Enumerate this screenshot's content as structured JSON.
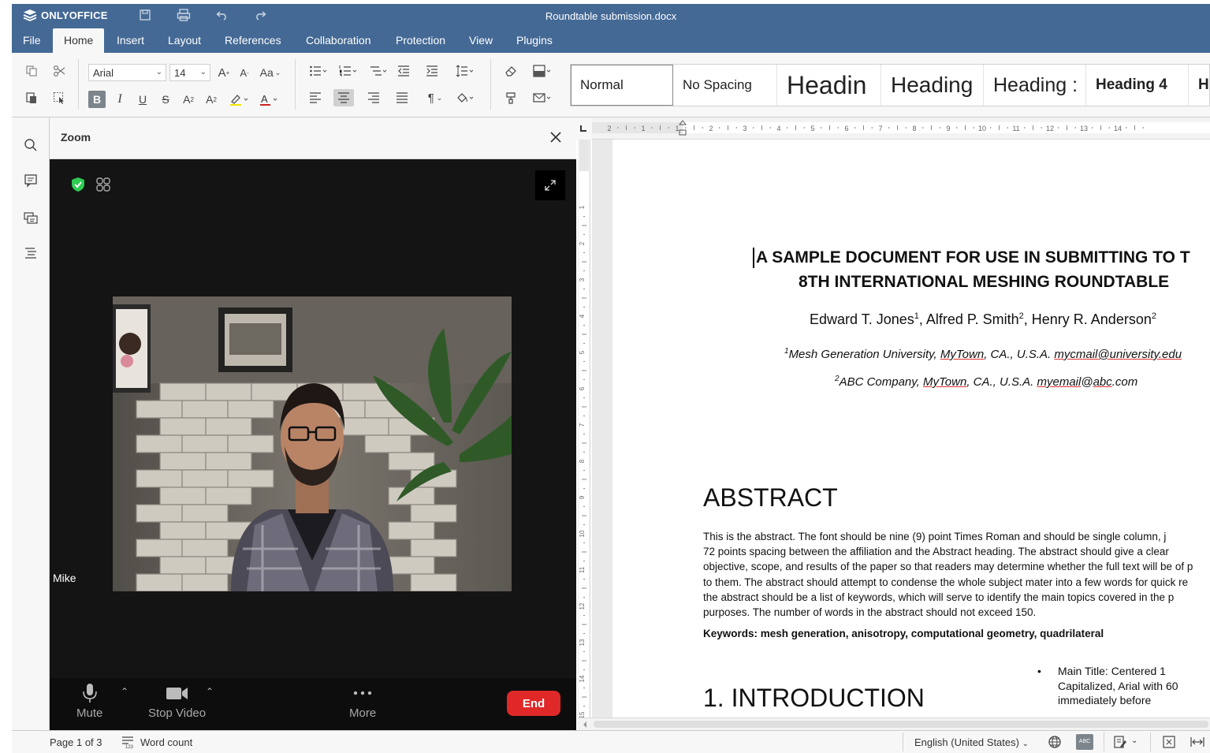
{
  "app": {
    "brand": "ONLYOFFICE",
    "document_title": "Roundtable submission.docx"
  },
  "menu": {
    "items": [
      "File",
      "Home",
      "Insert",
      "Layout",
      "References",
      "Collaboration",
      "Protection",
      "View",
      "Plugins"
    ],
    "active": "Home"
  },
  "toolbar": {
    "font_name": "Arial",
    "font_size": "14",
    "change_case_label": "Aa",
    "styles": [
      "Normal",
      "No Spacing",
      "Headin",
      "Heading",
      "Heading :",
      "Heading 4",
      "H"
    ]
  },
  "zoom_panel": {
    "title": "Zoom",
    "participant_name": "Mike",
    "controls": {
      "mute": "Mute",
      "stop_video": "Stop Video",
      "more": "More",
      "end": "End"
    }
  },
  "document": {
    "title_line1": "A SAMPLE DOCUMENT FOR USE IN SUBMITTING TO T",
    "title_line2": "8TH INTERNATIONAL MESHING ROUNDTABLE",
    "authors": {
      "a1": "Edward T. Jones",
      "sep1": ", ",
      "a2": "Alfred P. Smith",
      "sep2": ", ",
      "a3": "Henry R. Anderson",
      "s1": "1",
      "s2": "2",
      "s3": "2"
    },
    "affiliation1": {
      "sup": "1",
      "org": "Mesh Generation University, ",
      "town": "MyTown",
      "rest": ", CA., U.S.A. ",
      "email": "mycmail@university.edu"
    },
    "affiliation2": {
      "sup": "2",
      "org": "ABC Company, ",
      "town": "MyTown",
      "rest": ", CA., U.S.A. ",
      "email_user": "myemail",
      "email_at": "@",
      "email_domain": "abc",
      "email_tld": ".com"
    },
    "abstract_heading": "ABSTRACT",
    "abstract_lines": [
      "This is the abstract.  The font should be nine (9) point Times Roman and should be single column, j",
      "72 points spacing between the affiliation and the Abstract heading.  The abstract should give a clear",
      "objective, scope, and results of the paper so that readers may determine whether the full text will be of p",
      "to them.  The abstract should attempt to condense the whole subject mater into a few words for quick re",
      "the abstract should be a list of keywords, which will serve to identify the main topics covered in the p",
      "purposes.  The number of words in the abstract should not exceed 150."
    ],
    "keywords": "Keywords: mesh generation, anisotropy, computational geometry, quadrilateral",
    "intro_heading": "1. INTRODUCTION",
    "bullet_lines": [
      "Main  Title:  Centered  1",
      "Capitalized,  Arial  with  60",
      "immediately before"
    ]
  },
  "ruler": {
    "h_labels": [
      "2",
      "1",
      "1",
      "2",
      "3",
      "4",
      "5",
      "6",
      "7",
      "8",
      "9",
      "10",
      "11",
      "12",
      "13",
      "14"
    ],
    "v_labels": [
      "1",
      "2",
      "3",
      "4",
      "5",
      "6",
      "7",
      "8",
      "9",
      "10",
      "11",
      "12",
      "13",
      "14",
      "15"
    ]
  },
  "status": {
    "page": "Page 1 of 3",
    "word_count": "Word count",
    "language": "English (United States)"
  },
  "colors": {
    "header_blue": "#446995",
    "end_red": "#e02828",
    "shield_green": "#2fcb53"
  }
}
